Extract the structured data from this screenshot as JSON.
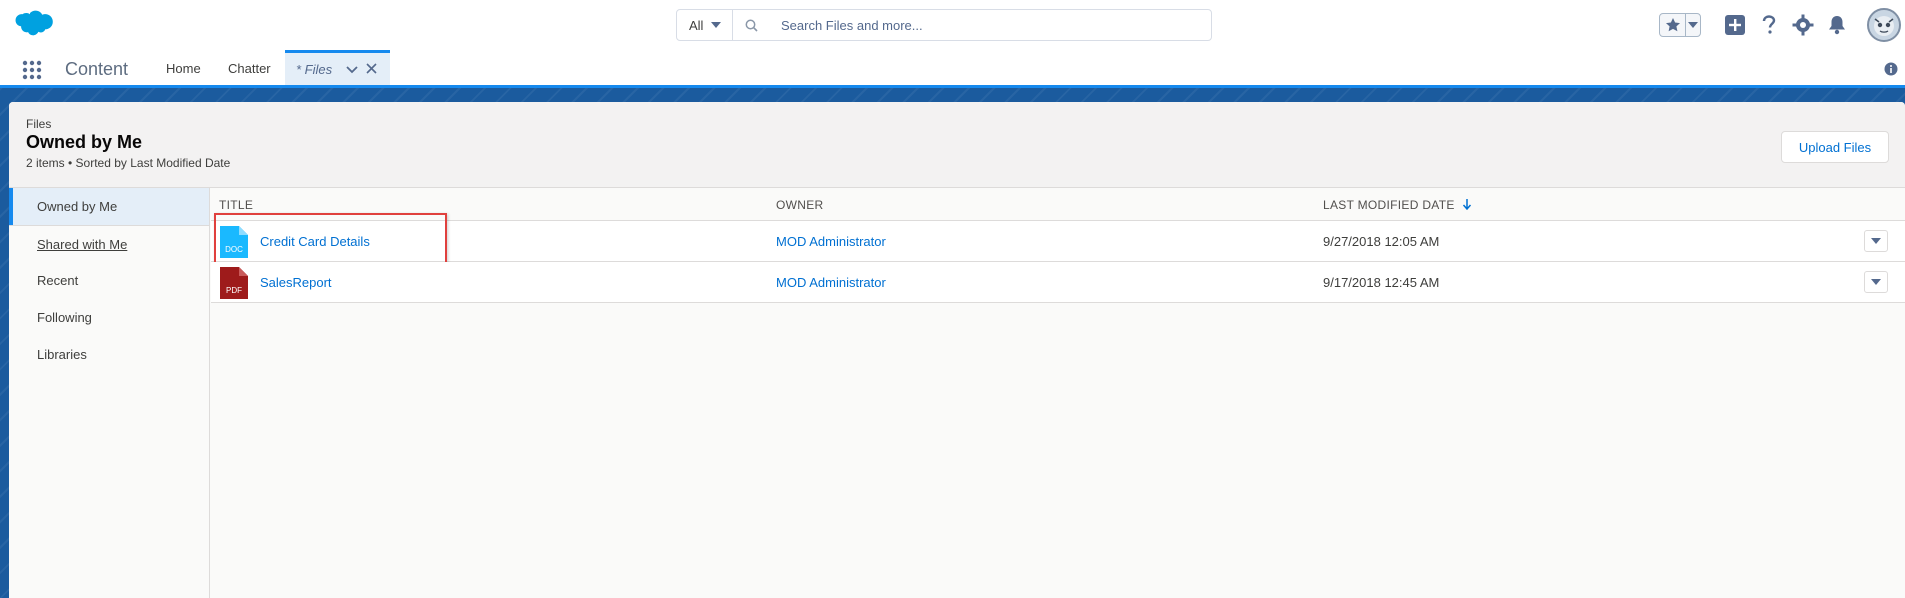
{
  "global_header": {
    "search_scope": "All",
    "search_placeholder": "Search Files and more..."
  },
  "app_nav": {
    "app_name": "Content",
    "items": [
      "Home",
      "Chatter"
    ],
    "active_tab": "* Files"
  },
  "page_header": {
    "eyebrow": "Files",
    "title": "Owned by Me",
    "meta": "2 items • Sorted by Last Modified Date",
    "upload_label": "Upload Files"
  },
  "sidebar": {
    "items": [
      "Owned by Me",
      "Shared with Me",
      "Recent",
      "Following",
      "Libraries"
    ]
  },
  "table": {
    "columns": [
      "TITLE",
      "OWNER",
      "LAST MODIFIED DATE"
    ],
    "rows": [
      {
        "type": "DOC",
        "title": "Credit Card Details",
        "owner": "MOD Administrator",
        "date": "9/27/2018 12:05 AM",
        "color": "#1ab9ff"
      },
      {
        "type": "PDF",
        "title": "SalesReport",
        "owner": "MOD Administrator",
        "date": "9/17/2018 12:45 AM",
        "color": "#9e1b1b"
      }
    ]
  },
  "colors": {
    "brand": "#1589ee",
    "link": "#0070d2",
    "highlight": "#e0403d"
  }
}
